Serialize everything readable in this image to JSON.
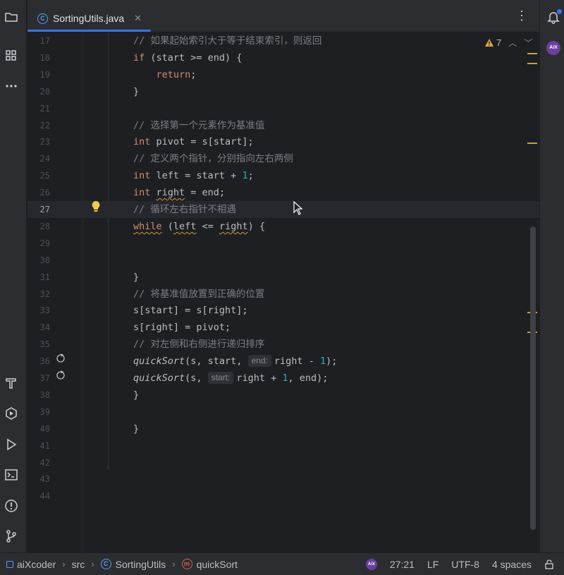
{
  "tab": {
    "title": "SortingUtils.java",
    "class_icon_letter": "C"
  },
  "inspections": {
    "warning_count": "7"
  },
  "code_lines": [
    {
      "n": "17",
      "tokens": [
        {
          "t": "cm",
          "v": "// 如果起始索引大于等于结束索引，则返回"
        }
      ]
    },
    {
      "n": "18",
      "tokens": [
        {
          "t": "kw",
          "v": "if"
        },
        {
          "t": "",
          "v": " (start >= end) {"
        }
      ]
    },
    {
      "n": "19",
      "tokens": [
        {
          "t": "",
          "v": "    "
        },
        {
          "t": "kw",
          "v": "return"
        },
        {
          "t": "",
          "v": ";"
        }
      ]
    },
    {
      "n": "20",
      "tokens": [
        {
          "t": "",
          "v": "}"
        }
      ]
    },
    {
      "n": "21",
      "tokens": []
    },
    {
      "n": "22",
      "tokens": [
        {
          "t": "cm",
          "v": "// 选择第一个元素作为基准值"
        }
      ]
    },
    {
      "n": "23",
      "tokens": [
        {
          "t": "kw",
          "v": "int"
        },
        {
          "t": "",
          "v": " pivot = s[start];"
        }
      ]
    },
    {
      "n": "24",
      "tokens": [
        {
          "t": "cm",
          "v": "// 定义两个指针，分别指向左右两侧"
        }
      ]
    },
    {
      "n": "25",
      "tokens": [
        {
          "t": "kw",
          "v": "int"
        },
        {
          "t": "",
          "v": " left = start + "
        },
        {
          "t": "num",
          "v": "1"
        },
        {
          "t": "",
          "v": ";"
        }
      ]
    },
    {
      "n": "26",
      "tokens": [
        {
          "t": "kw",
          "v": "int"
        },
        {
          "t": "",
          "v": " "
        },
        {
          "t": "squig",
          "v": "right"
        },
        {
          "t": "",
          "v": " = end;"
        }
      ]
    },
    {
      "n": "27",
      "tokens": [
        {
          "t": "cm",
          "v": "// 循环左右指针不相遇"
        }
      ]
    },
    {
      "n": "28",
      "tokens": [
        {
          "t": "kw squig",
          "v": "while"
        },
        {
          "t": "",
          "v": " ("
        },
        {
          "t": "squig",
          "v": "left"
        },
        {
          "t": "",
          "v": " <= "
        },
        {
          "t": "squig",
          "v": "right"
        },
        {
          "t": "",
          "v": ") {"
        }
      ]
    },
    {
      "n": "29",
      "tokens": []
    },
    {
      "n": "30",
      "tokens": []
    },
    {
      "n": "31",
      "tokens": [
        {
          "t": "",
          "v": "}"
        }
      ]
    },
    {
      "n": "32",
      "tokens": [
        {
          "t": "cm",
          "v": "// 将基准值放置到正确的位置"
        }
      ]
    },
    {
      "n": "33",
      "tokens": [
        {
          "t": "",
          "v": "s[start] = s[right];"
        }
      ]
    },
    {
      "n": "34",
      "tokens": [
        {
          "t": "",
          "v": "s[right] = pivot;"
        }
      ]
    },
    {
      "n": "35",
      "tokens": [
        {
          "t": "cm",
          "v": "// 对左侧和右侧进行递归排序"
        }
      ]
    },
    {
      "n": "36",
      "tokens": [
        {
          "t": "fn",
          "v": "quickSort"
        },
        {
          "t": "",
          "v": "(s, start, "
        },
        {
          "t": "hint",
          "v": "end:"
        },
        {
          "t": "",
          "v": "right - "
        },
        {
          "t": "num",
          "v": "1"
        },
        {
          "t": "",
          "v": ");"
        }
      ]
    },
    {
      "n": "37",
      "tokens": [
        {
          "t": "fn",
          "v": "quickSort"
        },
        {
          "t": "",
          "v": "(s, "
        },
        {
          "t": "hint",
          "v": "start:"
        },
        {
          "t": "",
          "v": "right + "
        },
        {
          "t": "num",
          "v": "1"
        },
        {
          "t": "",
          "v": ", end);"
        }
      ]
    },
    {
      "n": "38",
      "tokens": [
        {
          "t": "",
          "v": "}"
        }
      ]
    },
    {
      "n": "39",
      "tokens": []
    },
    {
      "n": "40",
      "tokens": [
        {
          "t": "",
          "v": "}"
        }
      ]
    },
    {
      "n": "41",
      "tokens": []
    },
    {
      "n": "42",
      "tokens": []
    },
    {
      "n": "43",
      "tokens": []
    },
    {
      "n": "44",
      "tokens": []
    }
  ],
  "current_line": "27",
  "statusbar": {
    "project": "aiXcoder",
    "folder": "src",
    "class_name": "SortingUtils",
    "method_name": "quickSort",
    "method_icon_letter": "m",
    "aix_label": "AiX",
    "position": "27:21",
    "line_ending": "LF",
    "encoding": "UTF-8",
    "indent": "4 spaces"
  },
  "side_badge": "AiX"
}
